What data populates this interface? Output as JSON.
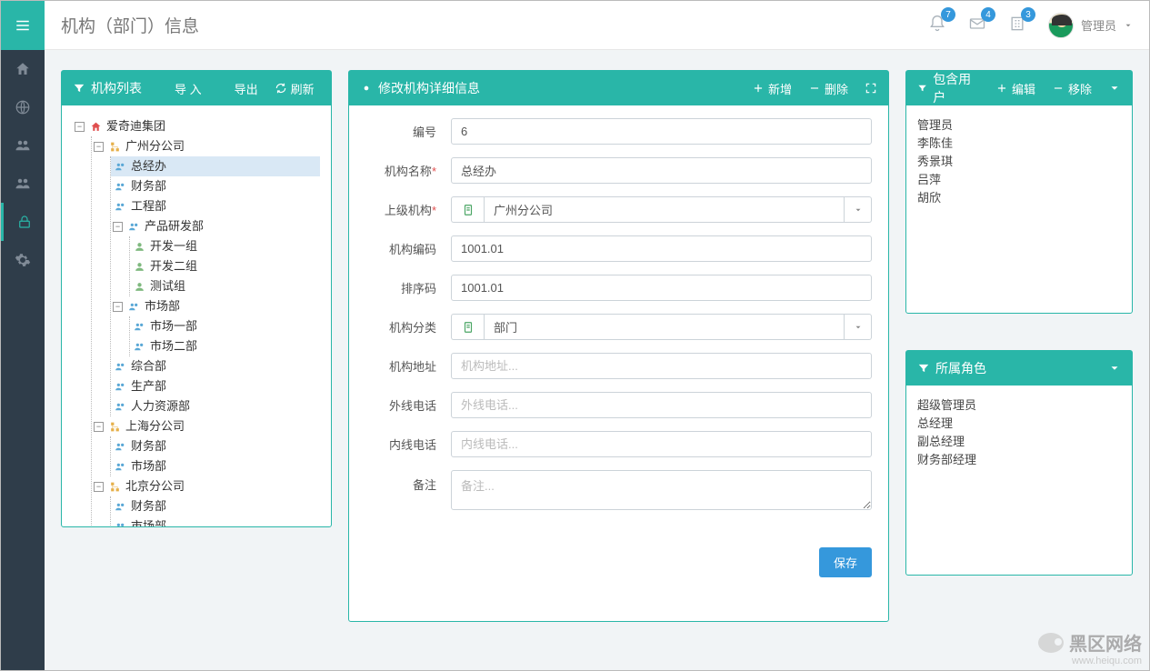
{
  "page_title": "机构（部门）信息",
  "topbar": {
    "notif_bell": 7,
    "notif_mail": 4,
    "notif_building": 3,
    "user_label": "管理员"
  },
  "tree_panel": {
    "title": "机构列表",
    "btn_import": "导 入",
    "btn_export": "导出",
    "btn_refresh": "刷新",
    "nodes": {
      "root": "爱奇迪集团",
      "gz": "广州分公司",
      "gz_children": [
        "总经办",
        "财务部",
        "工程部"
      ],
      "rnd": "产品研发部",
      "rnd_children": [
        "开发一组",
        "开发二组",
        "测试组"
      ],
      "market": "市场部",
      "market_children": [
        "市场一部",
        "市场二部"
      ],
      "gz_tail": [
        "综合部",
        "生产部",
        "人力资源部"
      ],
      "sh": "上海分公司",
      "sh_children": [
        "财务部",
        "市场部"
      ],
      "bj": "北京分公司",
      "bj_children": [
        "财务部",
        "市场部"
      ]
    }
  },
  "form_panel": {
    "title": "修改机构详细信息",
    "btn_add": "新增",
    "btn_delete": "删除",
    "labels": {
      "id": "编号",
      "name": "机构名称",
      "parent": "上级机构",
      "code": "机构编码",
      "sort": "排序码",
      "category": "机构分类",
      "address": "机构地址",
      "phone_out": "外线电话",
      "phone_in": "内线电话",
      "remark": "备注"
    },
    "placeholders": {
      "address": "机构地址...",
      "phone_out": "外线电话...",
      "phone_in": "内线电话...",
      "remark": "备注..."
    },
    "values": {
      "id": "6",
      "name": "总经办",
      "parent": "广州分公司",
      "code": "1001.01",
      "sort": "1001.01",
      "category": "部门"
    },
    "btn_save": "保存"
  },
  "users_panel": {
    "title": "包含用户",
    "btn_edit": "编辑",
    "btn_remove": "移除",
    "items": [
      "管理员",
      "李陈佳",
      "秀景琪",
      "吕萍",
      "胡欣"
    ]
  },
  "roles_panel": {
    "title": "所属角色",
    "items": [
      "超级管理员",
      "总经理",
      "副总经理",
      "财务部经理"
    ]
  },
  "watermark": {
    "t1": "黑区网络",
    "t2": "www.heiqu.com"
  }
}
